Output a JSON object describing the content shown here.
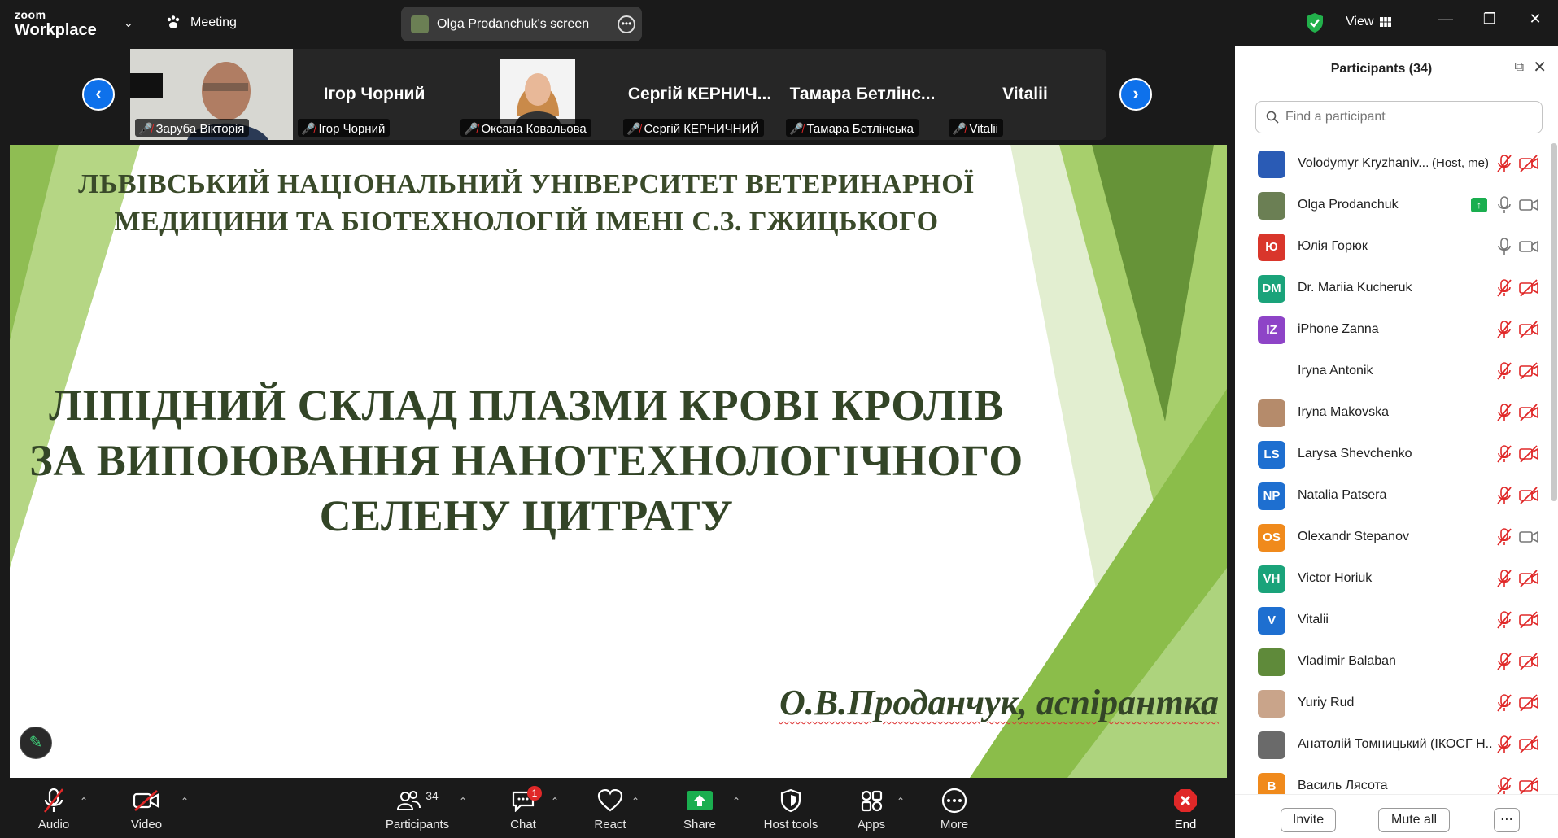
{
  "topbar": {
    "logo_top": "zoom",
    "logo_bottom": "Workplace",
    "meeting_label": "Meeting",
    "screen_label": "Olga Prodanchuk's screen",
    "view_label": "View"
  },
  "gallery": {
    "tiles": [
      {
        "big": "",
        "label": "Заруба Вікторія"
      },
      {
        "big": "Ігор Чорний",
        "label": "Ігор Чорний"
      },
      {
        "big": "",
        "label": "Оксана Ковальова"
      },
      {
        "big": "Сергій КЕРНИЧ...",
        "label": "Сергій КЕРНИЧНИЙ"
      },
      {
        "big": "Тамара Бетлінс...",
        "label": "Тамара Бетлінська"
      },
      {
        "big": "Vitalii",
        "label": "Vitalii"
      }
    ]
  },
  "slide": {
    "header_line1": "ЛЬВІВСЬКИЙ НАЦІОНАЛЬНИЙ УНІВЕРСИТЕТ ВЕТЕРИНАРНОЇ",
    "header_line2": "МЕДИЦИНИ ТА БІОТЕХНОЛОГІЙ ІМЕНІ С.З. ГЖИЦЬКОГО",
    "title_line1": "ЛІПІДНИЙ СКЛАД ПЛАЗМИ КРОВІ КРОЛІВ",
    "title_line2": "ЗА ВИПОЮВАННЯ НАНОТЕХНОЛОГІЧНОГО",
    "title_line3": "СЕЛЕНУ ЦИТРАТУ",
    "author": "О.В.Проданчук, аспірантка"
  },
  "toolbar": {
    "audio": "Audio",
    "video": "Video",
    "participants": "Participants",
    "participants_count": "34",
    "chat": "Chat",
    "chat_badge": "1",
    "react": "React",
    "share": "Share",
    "host_tools": "Host tools",
    "apps": "Apps",
    "more": "More",
    "end": "End"
  },
  "panel": {
    "title": "Participants (34)",
    "search_placeholder": "Find a participant",
    "invite": "Invite",
    "mute_all": "Mute all",
    "participants": [
      {
        "initials": "",
        "name": "Volodymyr Kryzhaniv...",
        "host": "(Host, me)",
        "color": "#2a5bb5",
        "mic": "muted",
        "cam": "off"
      },
      {
        "initials": "",
        "name": "Olga Prodanchuk",
        "color": "#6b7f54",
        "mic": "on",
        "cam": "on",
        "sharing": true
      },
      {
        "initials": "Ю",
        "name": "Юлія Горюк",
        "color": "#d9362b",
        "mic": "on",
        "cam": "on"
      },
      {
        "initials": "DM",
        "name": "Dr. Mariia Kucheruk",
        "color": "#1aa37a",
        "mic": "muted",
        "cam": "off"
      },
      {
        "initials": "IZ",
        "name": "iPhone Zanna",
        "color": "#8e44c7",
        "mic": "muted",
        "cam": "off"
      },
      {
        "initials": "",
        "name": "Iryna Antonik",
        "color": "#ffffff",
        "mic": "muted",
        "cam": "off"
      },
      {
        "initials": "",
        "name": "Iryna Makovska",
        "color": "#b58b6b",
        "mic": "muted",
        "cam": "off"
      },
      {
        "initials": "LS",
        "name": "Larysa Shevchenko",
        "color": "#1e6fd0",
        "mic": "muted",
        "cam": "off"
      },
      {
        "initials": "NP",
        "name": "Natalia Patsera",
        "color": "#1e6fd0",
        "mic": "muted",
        "cam": "off"
      },
      {
        "initials": "OS",
        "name": "Olexandr Stepanov",
        "color": "#f08a1c",
        "mic": "muted",
        "cam": "on"
      },
      {
        "initials": "VH",
        "name": "Victor Horiuk",
        "color": "#1aa37a",
        "mic": "muted",
        "cam": "off"
      },
      {
        "initials": "V",
        "name": "Vitalii",
        "color": "#1e6fd0",
        "mic": "muted",
        "cam": "off"
      },
      {
        "initials": "",
        "name": "Vladimir Balaban",
        "color": "#5f8a3a",
        "mic": "muted",
        "cam": "off"
      },
      {
        "initials": "",
        "name": "Yuriy Rud",
        "color": "#c9a48a",
        "mic": "muted",
        "cam": "off"
      },
      {
        "initials": "",
        "name": "Анатолій Томницький (ІКОСГ Н...",
        "color": "#6a6a6a",
        "mic": "muted",
        "cam": "off"
      },
      {
        "initials": "В",
        "name": "Василь Лясота",
        "color": "#f08a1c",
        "mic": "muted",
        "cam": "off"
      }
    ]
  },
  "colors": {
    "accent": "#0e71eb",
    "muted": "#e02828",
    "share_green": "#1aae4f",
    "slide_green": "#8bbd4a"
  }
}
